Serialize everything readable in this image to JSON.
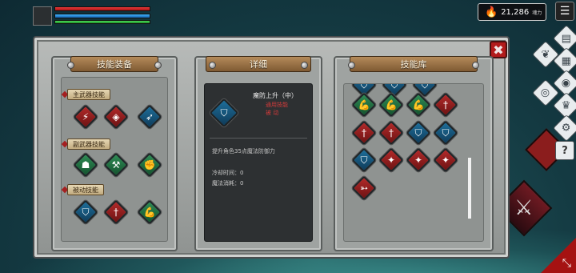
{
  "hud": {
    "hp_fill": 1.0,
    "mp_fill": 1.0,
    "xp_fill": 1.0,
    "currency_value": "21,286",
    "currency_unit": "魂力",
    "currency_icon": "flame-icon"
  },
  "colors": {
    "hp": "#d42a2a",
    "mp": "#2a8ad6",
    "xp": "#35c244",
    "close": "#b21b1b",
    "plaque": "#9a6e41",
    "active_tag": "#d23a3a"
  },
  "side_icons": [
    "menu-icon",
    "scroll-icon",
    "wing-icon",
    "eye-icon",
    "shield-icon",
    "crown-icon",
    "gear-icon",
    "help-icon"
  ],
  "panel": {
    "close_label": "✖",
    "equip": {
      "title": "技能装备",
      "main_weapon_label": "主武器技能",
      "sub_weapon_label": "副武器技能",
      "passive_label": "被动技能"
    },
    "detail": {
      "title": "详细",
      "skill_name": "魔防上升（中）",
      "skill_type": "通用技能",
      "skill_mode": "被 动",
      "description": "提升角色35点魔法防御力",
      "cooldown": "冷却时间：0",
      "mana_cost": "魔法消耗：0"
    },
    "library": {
      "title": "技能库"
    }
  },
  "help_label": "?"
}
